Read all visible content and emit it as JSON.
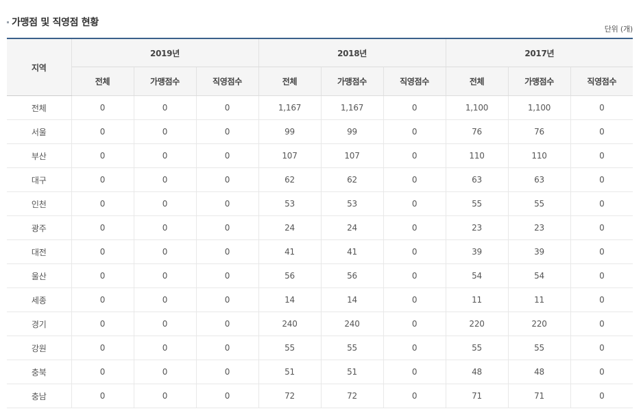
{
  "header": {
    "title": "가맹점 및 직영점 현황",
    "unit": "단위 (개)"
  },
  "table": {
    "region_header": "지역",
    "years": [
      "2019년",
      "2018년",
      "2017년"
    ],
    "sub_headers": [
      "전체",
      "가맹점수",
      "직영점수"
    ],
    "rows": [
      {
        "region": "전체",
        "values": [
          "0",
          "0",
          "0",
          "1,167",
          "1,167",
          "0",
          "1,100",
          "1,100",
          "0"
        ]
      },
      {
        "region": "서울",
        "values": [
          "0",
          "0",
          "0",
          "99",
          "99",
          "0",
          "76",
          "76",
          "0"
        ]
      },
      {
        "region": "부산",
        "values": [
          "0",
          "0",
          "0",
          "107",
          "107",
          "0",
          "110",
          "110",
          "0"
        ]
      },
      {
        "region": "대구",
        "values": [
          "0",
          "0",
          "0",
          "62",
          "62",
          "0",
          "63",
          "63",
          "0"
        ]
      },
      {
        "region": "인천",
        "values": [
          "0",
          "0",
          "0",
          "53",
          "53",
          "0",
          "55",
          "55",
          "0"
        ]
      },
      {
        "region": "광주",
        "values": [
          "0",
          "0",
          "0",
          "24",
          "24",
          "0",
          "23",
          "23",
          "0"
        ]
      },
      {
        "region": "대전",
        "values": [
          "0",
          "0",
          "0",
          "41",
          "41",
          "0",
          "39",
          "39",
          "0"
        ]
      },
      {
        "region": "울산",
        "values": [
          "0",
          "0",
          "0",
          "56",
          "56",
          "0",
          "54",
          "54",
          "0"
        ]
      },
      {
        "region": "세종",
        "values": [
          "0",
          "0",
          "0",
          "14",
          "14",
          "0",
          "11",
          "11",
          "0"
        ]
      },
      {
        "region": "경기",
        "values": [
          "0",
          "0",
          "0",
          "240",
          "240",
          "0",
          "220",
          "220",
          "0"
        ]
      },
      {
        "region": "강원",
        "values": [
          "0",
          "0",
          "0",
          "55",
          "55",
          "0",
          "55",
          "55",
          "0"
        ]
      },
      {
        "region": "충북",
        "values": [
          "0",
          "0",
          "0",
          "51",
          "51",
          "0",
          "48",
          "48",
          "0"
        ]
      },
      {
        "region": "충남",
        "values": [
          "0",
          "0",
          "0",
          "72",
          "72",
          "0",
          "71",
          "71",
          "0"
        ]
      }
    ]
  },
  "colors": {
    "header_top_border": "#3a5f8a",
    "header_bg": "#f5f5f5"
  }
}
